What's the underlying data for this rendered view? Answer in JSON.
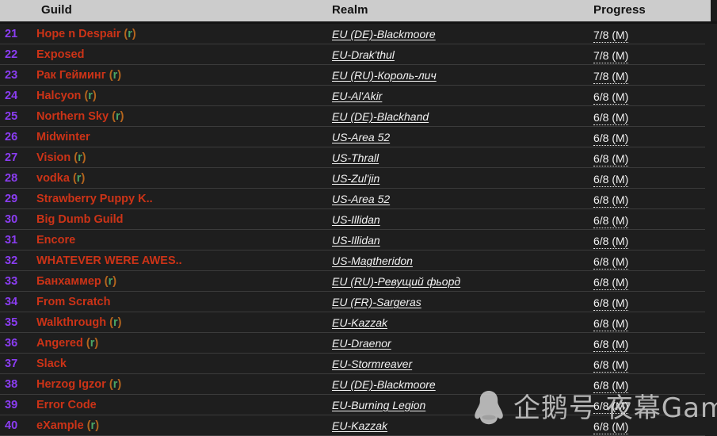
{
  "table": {
    "columns": {
      "rank": "",
      "guild": "Guild",
      "realm": "Realm",
      "progress": "Progress"
    },
    "rows": [
      {
        "rank": "21",
        "guild": "Hope n Despair",
        "recruiting": "(r)",
        "realm": "EU (DE)-Blackmoore",
        "progress": "7/8 (M)"
      },
      {
        "rank": "22",
        "guild": "Exposed",
        "recruiting": "",
        "realm": "EU-Drak'thul",
        "progress": "7/8 (M)"
      },
      {
        "rank": "23",
        "guild": "Рак Гейминг",
        "recruiting": "(r)",
        "realm": "EU (RU)-Король-лич",
        "progress": "7/8 (M)"
      },
      {
        "rank": "24",
        "guild": "Halcyon",
        "recruiting": "(r)",
        "realm": "EU-Al'Akir",
        "progress": "6/8 (M)"
      },
      {
        "rank": "25",
        "guild": "Northern Sky",
        "recruiting": "(r)",
        "realm": "EU (DE)-Blackhand",
        "progress": "6/8 (M)"
      },
      {
        "rank": "26",
        "guild": "Midwinter",
        "recruiting": "",
        "realm": "US-Area 52",
        "progress": "6/8 (M)"
      },
      {
        "rank": "27",
        "guild": "Vision",
        "recruiting": "(r)",
        "realm": "US-Thrall",
        "progress": "6/8 (M)"
      },
      {
        "rank": "28",
        "guild": "vodka",
        "recruiting": "(r)",
        "realm": "US-Zul'jin",
        "progress": "6/8 (M)"
      },
      {
        "rank": "29",
        "guild": "Strawberry Puppy K..",
        "recruiting": "",
        "realm": "US-Area 52",
        "progress": "6/8 (M)"
      },
      {
        "rank": "30",
        "guild": "Big Dumb Guild",
        "recruiting": "",
        "realm": "US-Illidan",
        "progress": "6/8 (M)"
      },
      {
        "rank": "31",
        "guild": "Encore",
        "recruiting": "",
        "realm": "US-Illidan",
        "progress": "6/8 (M)"
      },
      {
        "rank": "32",
        "guild": "WHATEVER WERE AWES..",
        "recruiting": "",
        "realm": "US-Magtheridon",
        "progress": "6/8 (M)"
      },
      {
        "rank": "33",
        "guild": "Банхаммер",
        "recruiting": "(r)",
        "realm": "EU (RU)-Ревущий фьорд",
        "progress": "6/8 (M)"
      },
      {
        "rank": "34",
        "guild": "From Scratch",
        "recruiting": "",
        "realm": "EU (FR)-Sargeras",
        "progress": "6/8 (M)"
      },
      {
        "rank": "35",
        "guild": "Walkthrough",
        "recruiting": "(r)",
        "realm": "EU-Kazzak",
        "progress": "6/8 (M)"
      },
      {
        "rank": "36",
        "guild": "Angered",
        "recruiting": "(r)",
        "realm": "EU-Draenor",
        "progress": "6/8 (M)"
      },
      {
        "rank": "37",
        "guild": "Slack",
        "recruiting": "",
        "realm": "EU-Stormreaver",
        "progress": "6/8 (M)"
      },
      {
        "rank": "38",
        "guild": "Herzog Igzor",
        "recruiting": "(r)",
        "realm": "EU (DE)-Blackmoore",
        "progress": "6/8 (M)"
      },
      {
        "rank": "39",
        "guild": "Error Code",
        "recruiting": "",
        "realm": "EU-Burning Legion",
        "progress": "6/8 (M)"
      },
      {
        "rank": "40",
        "guild": "eXample",
        "recruiting": "(r)",
        "realm": "EU-Kazzak",
        "progress": "6/8 (M)"
      }
    ]
  },
  "watermark": {
    "icon": "penguin-icon",
    "text": "企鹅号 夜幕Game"
  },
  "colors": {
    "header_bg": "#cccccc",
    "row_bg": "#1e1e1e",
    "rank": "#8b3df2",
    "guild": "#cc3317",
    "recruiting": "#4aa564",
    "paren": "#b5651d",
    "realm": "#f2f2f2",
    "progress": "#f2f2f2",
    "separator": "#3b3b3b"
  }
}
